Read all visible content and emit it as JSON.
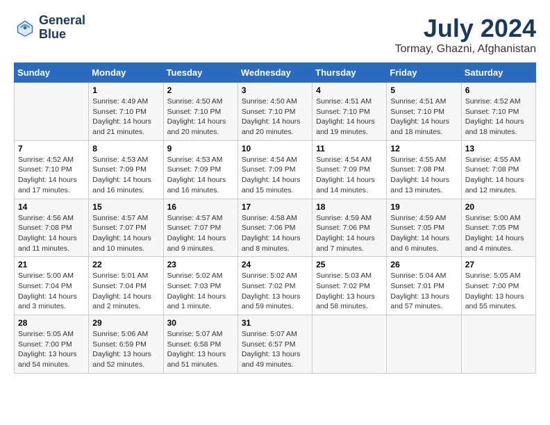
{
  "header": {
    "logo_line1": "General",
    "logo_line2": "Blue",
    "month": "July 2024",
    "location": "Tormay, Ghazni, Afghanistan"
  },
  "weekdays": [
    "Sunday",
    "Monday",
    "Tuesday",
    "Wednesday",
    "Thursday",
    "Friday",
    "Saturday"
  ],
  "weeks": [
    [
      {
        "day": "",
        "info": ""
      },
      {
        "day": "1",
        "info": "Sunrise: 4:49 AM\nSunset: 7:10 PM\nDaylight: 14 hours\nand 21 minutes."
      },
      {
        "day": "2",
        "info": "Sunrise: 4:50 AM\nSunset: 7:10 PM\nDaylight: 14 hours\nand 20 minutes."
      },
      {
        "day": "3",
        "info": "Sunrise: 4:50 AM\nSunset: 7:10 PM\nDaylight: 14 hours\nand 20 minutes."
      },
      {
        "day": "4",
        "info": "Sunrise: 4:51 AM\nSunset: 7:10 PM\nDaylight: 14 hours\nand 19 minutes."
      },
      {
        "day": "5",
        "info": "Sunrise: 4:51 AM\nSunset: 7:10 PM\nDaylight: 14 hours\nand 18 minutes."
      },
      {
        "day": "6",
        "info": "Sunrise: 4:52 AM\nSunset: 7:10 PM\nDaylight: 14 hours\nand 18 minutes."
      }
    ],
    [
      {
        "day": "7",
        "info": "Sunrise: 4:52 AM\nSunset: 7:10 PM\nDaylight: 14 hours\nand 17 minutes."
      },
      {
        "day": "8",
        "info": "Sunrise: 4:53 AM\nSunset: 7:09 PM\nDaylight: 14 hours\nand 16 minutes."
      },
      {
        "day": "9",
        "info": "Sunrise: 4:53 AM\nSunset: 7:09 PM\nDaylight: 14 hours\nand 16 minutes."
      },
      {
        "day": "10",
        "info": "Sunrise: 4:54 AM\nSunset: 7:09 PM\nDaylight: 14 hours\nand 15 minutes."
      },
      {
        "day": "11",
        "info": "Sunrise: 4:54 AM\nSunset: 7:09 PM\nDaylight: 14 hours\nand 14 minutes."
      },
      {
        "day": "12",
        "info": "Sunrise: 4:55 AM\nSunset: 7:08 PM\nDaylight: 14 hours\nand 13 minutes."
      },
      {
        "day": "13",
        "info": "Sunrise: 4:55 AM\nSunset: 7:08 PM\nDaylight: 14 hours\nand 12 minutes."
      }
    ],
    [
      {
        "day": "14",
        "info": "Sunrise: 4:56 AM\nSunset: 7:08 PM\nDaylight: 14 hours\nand 11 minutes."
      },
      {
        "day": "15",
        "info": "Sunrise: 4:57 AM\nSunset: 7:07 PM\nDaylight: 14 hours\nand 10 minutes."
      },
      {
        "day": "16",
        "info": "Sunrise: 4:57 AM\nSunset: 7:07 PM\nDaylight: 14 hours\nand 9 minutes."
      },
      {
        "day": "17",
        "info": "Sunrise: 4:58 AM\nSunset: 7:06 PM\nDaylight: 14 hours\nand 8 minutes."
      },
      {
        "day": "18",
        "info": "Sunrise: 4:59 AM\nSunset: 7:06 PM\nDaylight: 14 hours\nand 7 minutes."
      },
      {
        "day": "19",
        "info": "Sunrise: 4:59 AM\nSunset: 7:05 PM\nDaylight: 14 hours\nand 6 minutes."
      },
      {
        "day": "20",
        "info": "Sunrise: 5:00 AM\nSunset: 7:05 PM\nDaylight: 14 hours\nand 4 minutes."
      }
    ],
    [
      {
        "day": "21",
        "info": "Sunrise: 5:00 AM\nSunset: 7:04 PM\nDaylight: 14 hours\nand 3 minutes."
      },
      {
        "day": "22",
        "info": "Sunrise: 5:01 AM\nSunset: 7:04 PM\nDaylight: 14 hours\nand 2 minutes."
      },
      {
        "day": "23",
        "info": "Sunrise: 5:02 AM\nSunset: 7:03 PM\nDaylight: 14 hours\nand 1 minute."
      },
      {
        "day": "24",
        "info": "Sunrise: 5:02 AM\nSunset: 7:02 PM\nDaylight: 13 hours\nand 59 minutes."
      },
      {
        "day": "25",
        "info": "Sunrise: 5:03 AM\nSunset: 7:02 PM\nDaylight: 13 hours\nand 58 minutes."
      },
      {
        "day": "26",
        "info": "Sunrise: 5:04 AM\nSunset: 7:01 PM\nDaylight: 13 hours\nand 57 minutes."
      },
      {
        "day": "27",
        "info": "Sunrise: 5:05 AM\nSunset: 7:00 PM\nDaylight: 13 hours\nand 55 minutes."
      }
    ],
    [
      {
        "day": "28",
        "info": "Sunrise: 5:05 AM\nSunset: 7:00 PM\nDaylight: 13 hours\nand 54 minutes."
      },
      {
        "day": "29",
        "info": "Sunrise: 5:06 AM\nSunset: 6:59 PM\nDaylight: 13 hours\nand 52 minutes."
      },
      {
        "day": "30",
        "info": "Sunrise: 5:07 AM\nSunset: 6:58 PM\nDaylight: 13 hours\nand 51 minutes."
      },
      {
        "day": "31",
        "info": "Sunrise: 5:07 AM\nSunset: 6:57 PM\nDaylight: 13 hours\nand 49 minutes."
      },
      {
        "day": "",
        "info": ""
      },
      {
        "day": "",
        "info": ""
      },
      {
        "day": "",
        "info": ""
      }
    ]
  ]
}
